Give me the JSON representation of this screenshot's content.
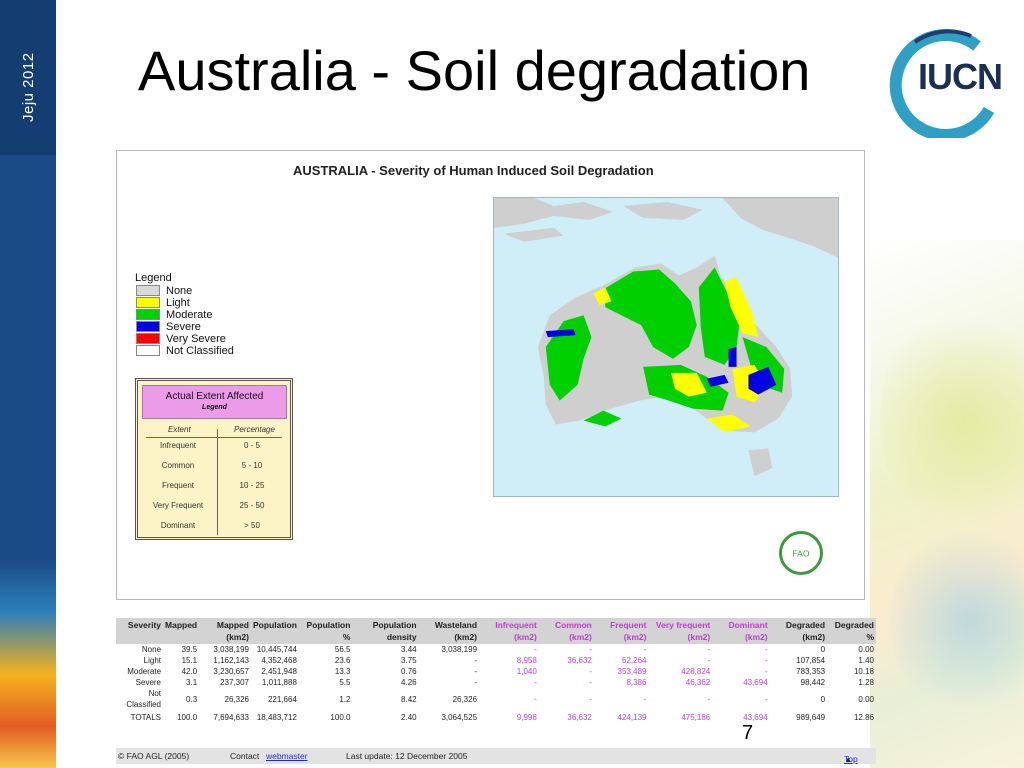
{
  "sidebar": {
    "label": "Jeju  2012"
  },
  "slide": {
    "title": "Australia - Soil degradation",
    "page_number": "7"
  },
  "logo": {
    "text": "IUCN"
  },
  "map": {
    "title": "AUSTRALIA - Severity of Human Induced Soil Degradation",
    "legend_title": "Legend",
    "legend": [
      {
        "label": "None",
        "color": "#d9d9d9"
      },
      {
        "label": "Light",
        "color": "#ffff00"
      },
      {
        "label": "Moderate",
        "color": "#00d000"
      },
      {
        "label": "Severe",
        "color": "#0000e0"
      },
      {
        "label": "Very Severe",
        "color": "#ff0000"
      },
      {
        "label": "Not Classified",
        "color": "#ffffff"
      }
    ],
    "extent_box": {
      "heading": "Actual Extent Affected",
      "subheading": "Legend",
      "col_extent": "Extent",
      "col_percentage": "Percentage",
      "rows": [
        {
          "extent": "Infrequent",
          "percentage": "0 - 5"
        },
        {
          "extent": "Common",
          "percentage": "5 - 10"
        },
        {
          "extent": "Frequent",
          "percentage": "10 - 25"
        },
        {
          "extent": "Very Frequent",
          "percentage": "25 - 50"
        },
        {
          "extent": "Dominant",
          "percentage": "> 50"
        }
      ]
    },
    "fao_logo_text": "FAO"
  },
  "table": {
    "headers": [
      "Severity",
      "Mapped",
      "Mapped (km2)",
      "Population",
      "Population %",
      "Population density",
      "Wasteland (km2)",
      "Infrequent (km2)",
      "Common (km2)",
      "Frequent (km2)",
      "Very frequent (km2)",
      "Dominant (km2)",
      "Degraded (km2)",
      "Degraded %"
    ],
    "rows": [
      [
        "None",
        "39.5",
        "3,038,199",
        "10,445,744",
        "56.5",
        "3.44",
        "3,038,199",
        "-",
        "-",
        "-",
        "-",
        "-",
        "0",
        "0.00"
      ],
      [
        "Light",
        "15.1",
        "1,162,143",
        "4,352,468",
        "23.6",
        "3.75",
        "-",
        "8,958",
        "36,632",
        "62,264",
        "-",
        "-",
        "107,854",
        "1.40"
      ],
      [
        "Moderate",
        "42.0",
        "3,230,657",
        "2,451,948",
        "13.3",
        "0.76",
        "-",
        "1,040",
        "-",
        "353,489",
        "428,824",
        "-",
        "783,353",
        "10.18"
      ],
      [
        "Severe",
        "3.1",
        "237,307",
        "1,011,888",
        "5.5",
        "4.26",
        "-",
        "-",
        "-",
        "8,386",
        "46,362",
        "43,694",
        "98,442",
        "1.28"
      ],
      [
        "Not Classified",
        "0.3",
        "26,326",
        "221,664",
        "1.2",
        "8.42",
        "26,326",
        "-",
        "-",
        "-",
        "-",
        "-",
        "0",
        "0.00"
      ],
      [
        "TOTALS",
        "100.0",
        "7,694,633",
        "18,483,712",
        "100.0",
        "2.40",
        "3,064,525",
        "9,998",
        "36,632",
        "424,139",
        "475,186",
        "43,694",
        "989,649",
        "12.86"
      ]
    ]
  },
  "footer": {
    "copyright": "© FAO AGL (2005)",
    "contact_label": "Contact",
    "contact_link": "webmaster",
    "last_update": "Last update: 12 December 2005",
    "top_link": "Top"
  }
}
